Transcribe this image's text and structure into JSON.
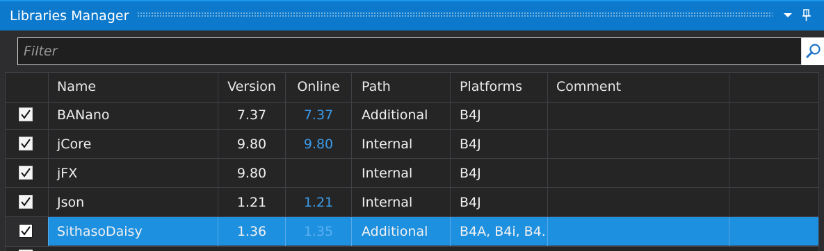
{
  "panel": {
    "title": "Libraries Manager"
  },
  "filter": {
    "placeholder": "Filter",
    "value": ""
  },
  "table": {
    "headers": [
      "Name",
      "Version",
      "Online",
      "Path",
      "Platforms",
      "Comment"
    ],
    "rows": [
      {
        "checked": true,
        "name": "BANano",
        "version": "7.37",
        "online": "7.37",
        "path": "Additional",
        "platforms": "B4J",
        "comment": ""
      },
      {
        "checked": true,
        "name": "jCore",
        "version": "9.80",
        "online": "9.80",
        "path": "Internal",
        "platforms": "B4J",
        "comment": ""
      },
      {
        "checked": true,
        "name": "jFX",
        "version": "9.80",
        "online": "",
        "path": "Internal",
        "platforms": "B4J",
        "comment": ""
      },
      {
        "checked": true,
        "name": "Json",
        "version": "1.21",
        "online": "1.21",
        "path": "Internal",
        "platforms": "B4J",
        "comment": ""
      },
      {
        "checked": true,
        "name": "SithasoDaisy",
        "version": "1.36",
        "online": "1.35",
        "path": "Additional",
        "platforms": "B4A, B4i, B4.",
        "comment": "",
        "selected": true
      }
    ]
  },
  "icons": {
    "panel_menu": "chevron-down-icon",
    "panel_pin": "pin-icon",
    "filter_search": "search-icon",
    "row_search": "search-icon",
    "checkbox": "checkmark-icon"
  },
  "colors": {
    "title_bar": "#0c79cc",
    "background": "#252526",
    "selection": "#1e90e0",
    "online_version": "#3b9be8"
  }
}
